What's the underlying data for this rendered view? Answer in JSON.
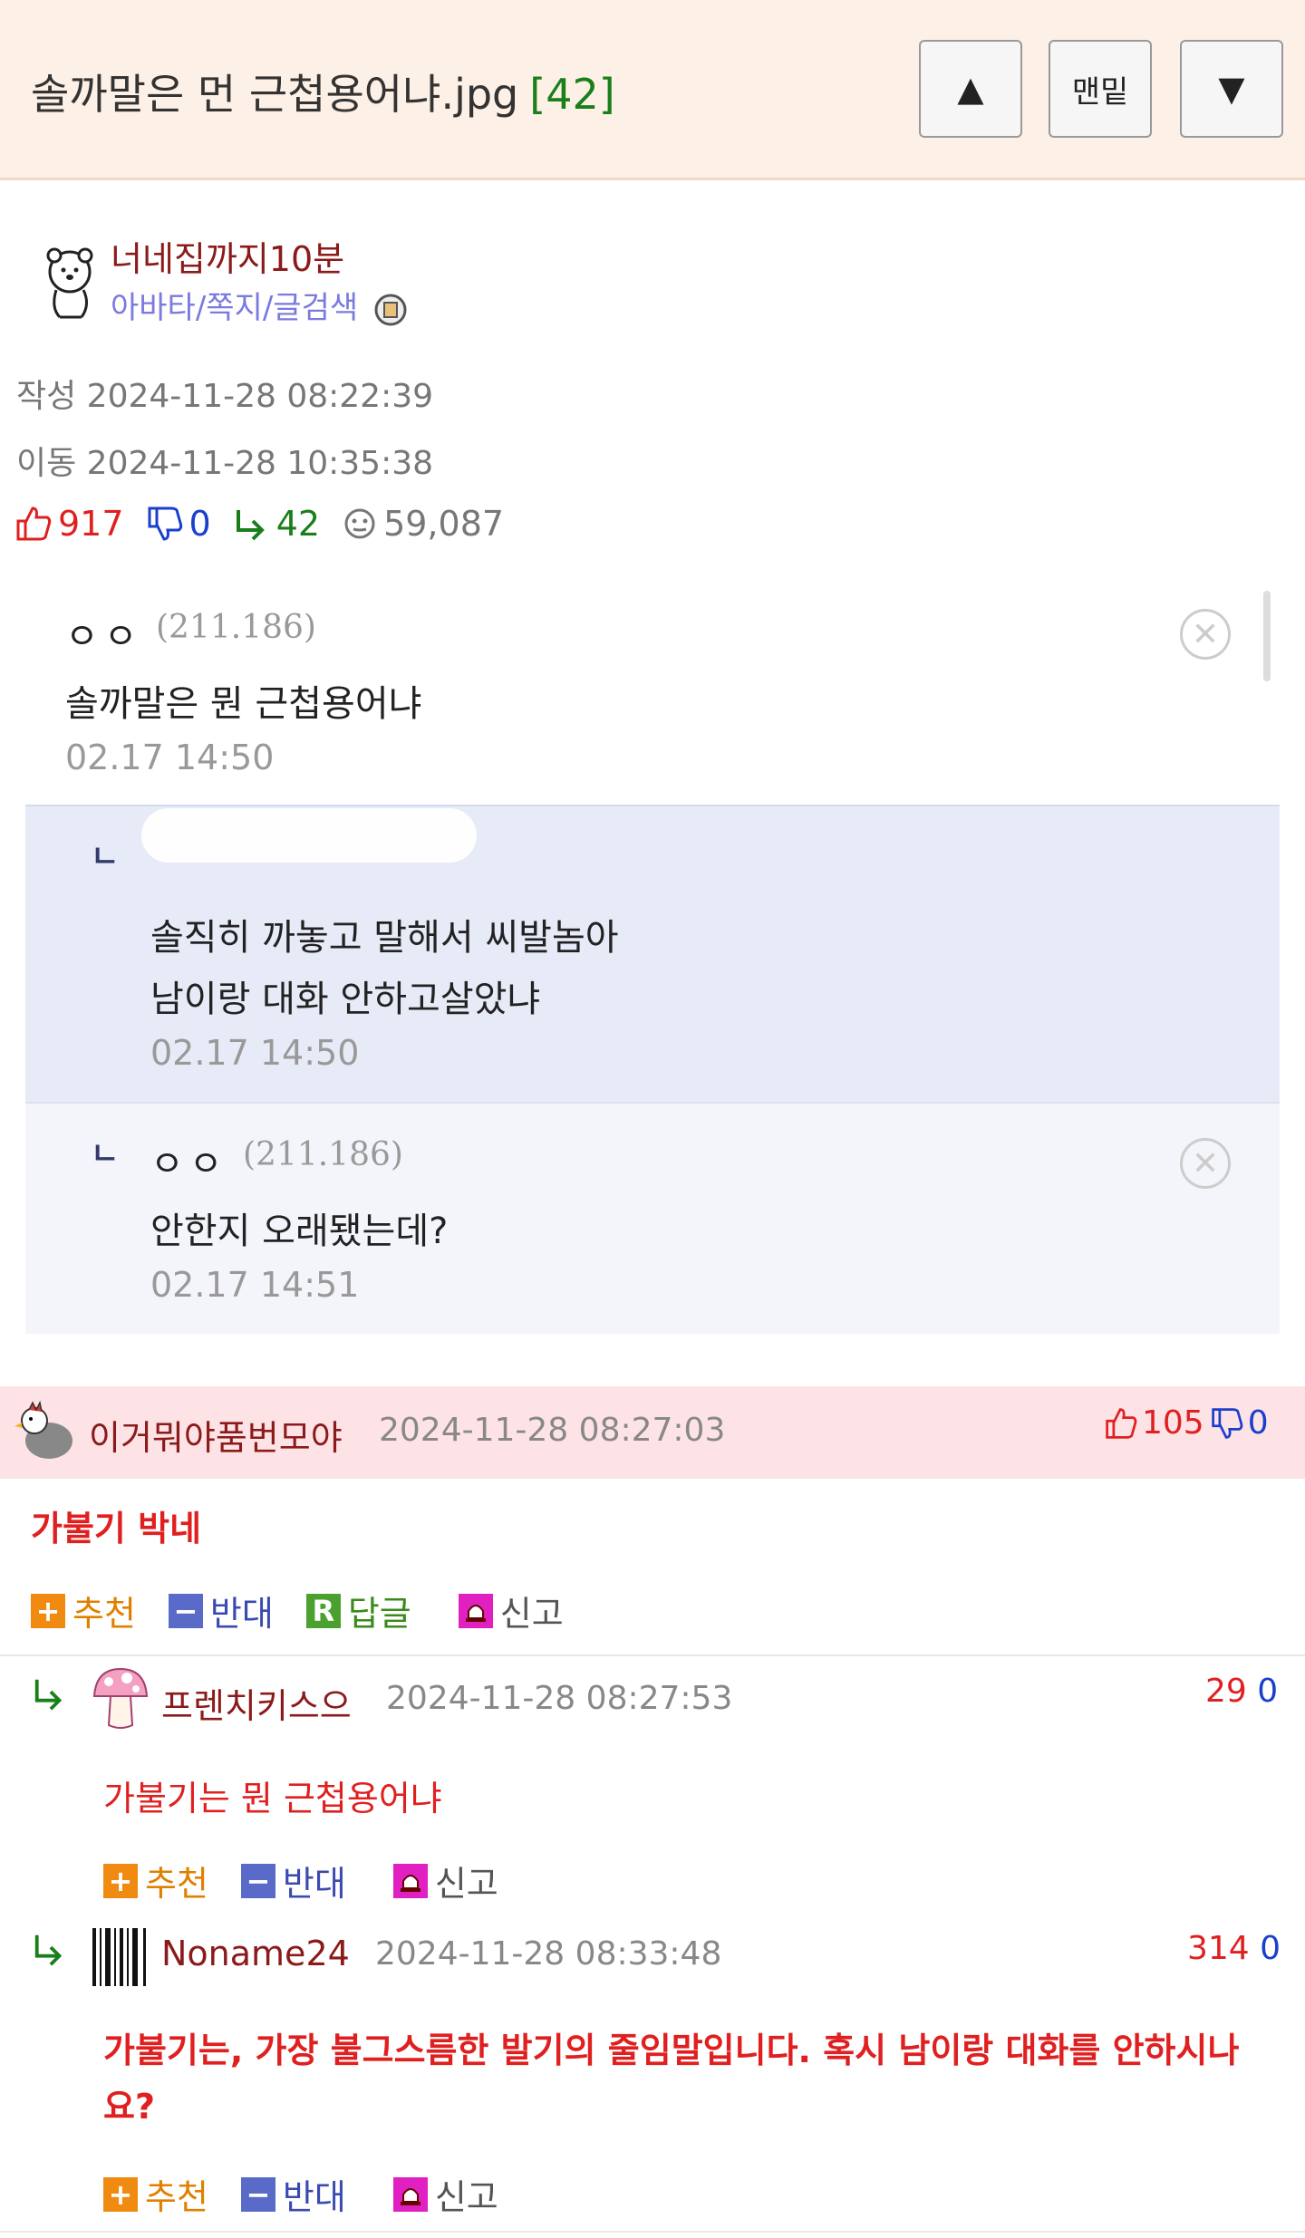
{
  "header": {
    "title": "솔까말은 먼 근첩용어냐.jpg",
    "comment_count": "[42]",
    "up_label": "▲",
    "bottom_label": "맨밑",
    "down_label": "▼"
  },
  "post": {
    "author": "너네집까지10분",
    "author_links": "아바타/쪽지/글검색",
    "created": "작성 2024-11-28 08:22:39",
    "moved": "이동 2024-11-28 10:35:38",
    "stats": {
      "likes": "917",
      "dislikes": "0",
      "replies": "42",
      "views": "59,087"
    }
  },
  "screenshot": {
    "comment": {
      "nick": "ㅇㅇ",
      "ip": "(211.186)",
      "text": "솔까말은 뭔 근첩용어냐",
      "time": "02.17 14:50"
    },
    "reply1": {
      "line1": "솔직히 까놓고 말해서 씨발놈아",
      "line2": "남이랑 대화 안하고살았냐",
      "time": "02.17 14:50"
    },
    "reply2": {
      "nick": "ㅇㅇ",
      "ip": "(211.186)",
      "text": "안한지 오래됐는데?",
      "time": "02.17 14:51"
    }
  },
  "comments": [
    {
      "nick": "이거뭐야품번모야",
      "date": "2024-11-28 08:27:03",
      "likes": "105",
      "dislikes": "0",
      "text": "가불기 박네",
      "actions": {
        "recommend": "추천",
        "oppose": "반대",
        "reply": "답글",
        "report": "신고"
      }
    },
    {
      "nick": "프렌치키스으",
      "date": "2024-11-28 08:27:53",
      "likes": "29",
      "dislikes": "0",
      "text": "가불기는 뭔 근첩용어냐",
      "actions": {
        "recommend": "추천",
        "oppose": "반대",
        "report": "신고"
      }
    },
    {
      "nick": "Noname24",
      "date": "2024-11-28 08:33:48",
      "likes": "314",
      "dislikes": "0",
      "text": "가불기는, 가장 불그스름한 발기의 줄임말입니다. 혹시 남이랑 대화를 안하시나요?",
      "actions": {
        "recommend": "추천",
        "oppose": "반대",
        "report": "신고"
      }
    }
  ],
  "colors": {
    "header_bg": "#fdf0e6",
    "comment_bar_bg": "#fde3e6",
    "reply_bg": "#e6ebf7",
    "accent_red": "#e02020",
    "accent_green": "#1a7f1a",
    "accent_blue": "#1a3fcc"
  }
}
